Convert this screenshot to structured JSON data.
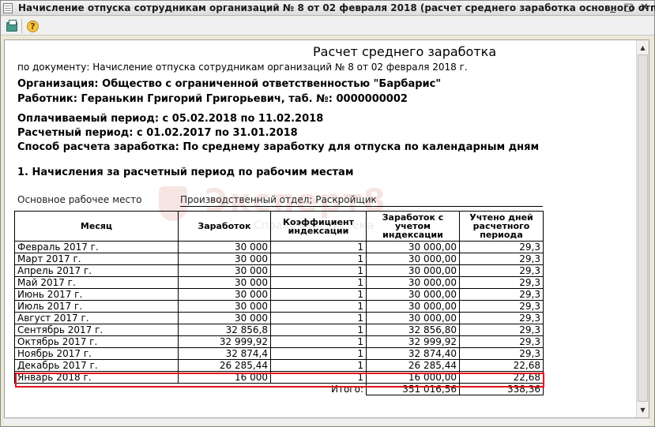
{
  "window": {
    "title": "Начисление отпуска сотрудникам организаций № 8 от 02 февраля 2018 (расчет среднего заработка основного отпуска)",
    "controls": {
      "minimize": "_",
      "maximize": "□",
      "close": "✕"
    }
  },
  "toolbar": {
    "print_icon": "print-icon",
    "help_icon": "help-icon",
    "help_glyph": "?"
  },
  "report": {
    "title": "Расчет среднего заработка",
    "by_document": "по документу: Начисление отпуска сотрудникам организаций № 8 от 02 февраля 2018 г.",
    "organization": "Организация: Общество с ограниченной ответственностью \"Барбарис\"",
    "worker": "Работник: Геранькин Григорий Григорьевич, таб. №: 0000000002",
    "paid_period": "Оплачиваемый период: с 05.02.2018 по 11.02.2018",
    "calc_period": "Расчетный период: с 01.02.2017 по 31.01.2018",
    "method": "Способ расчета заработка: По среднему заработку для отпуска по календарным дням",
    "section1": "1. Начисления за расчетный период по рабочим местам",
    "workplace_label": "Основное рабочее место",
    "workplace_value": "Производственный отдел; Раскройщик"
  },
  "table": {
    "headers": [
      "Месяц",
      "Заработок",
      "Коэффициент индексации",
      "Заработок с учетом индексации",
      "Учтено дней расчетного периода"
    ],
    "rows": [
      [
        "Февраль 2017 г.",
        "30 000",
        "1",
        "30 000,00",
        "29,3"
      ],
      [
        "Март 2017 г.",
        "30 000",
        "1",
        "30 000,00",
        "29,3"
      ],
      [
        "Апрель 2017 г.",
        "30 000",
        "1",
        "30 000,00",
        "29,3"
      ],
      [
        "Май 2017 г.",
        "30 000",
        "1",
        "30 000,00",
        "29,3"
      ],
      [
        "Июнь 2017 г.",
        "30 000",
        "1",
        "30 000,00",
        "29,3"
      ],
      [
        "Июль 2017 г.",
        "30 000",
        "1",
        "30 000,00",
        "29,3"
      ],
      [
        "Август 2017 г.",
        "30 000",
        "1",
        "30 000,00",
        "29,3"
      ],
      [
        "Сентябрь 2017 г.",
        "32 856,8",
        "1",
        "32 856,80",
        "29,3"
      ],
      [
        "Октябрь 2017 г.",
        "32 999,92",
        "1",
        "32 999,92",
        "29,3"
      ],
      [
        "Ноябрь 2017 г.",
        "32 874,4",
        "1",
        "32 874,40",
        "29,3"
      ],
      [
        "Декабрь 2017 г.",
        "26 285,44",
        "1",
        "26 285,44",
        "22,68"
      ],
      [
        "Январь 2018 г.",
        "16 000",
        "1",
        "16 000,00",
        "22,68"
      ]
    ],
    "total_label": "Итого:",
    "total_indexed": "351 016,56",
    "total_days": "338,36"
  },
  "watermark": {
    "text": "Эксперт8",
    "sub": "Справочная система"
  },
  "colors": {
    "highlight": "#e3101a"
  }
}
